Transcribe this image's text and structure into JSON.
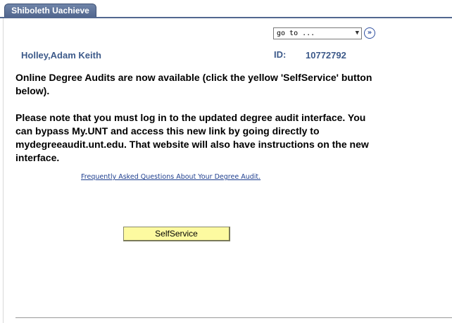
{
  "tab": {
    "label": "Shiboleth Uachieve"
  },
  "navigation": {
    "goto_value": "go to ...",
    "goto_icon": "chevron-down-icon",
    "go_icon": "double-chevron-right-icon"
  },
  "student": {
    "name": "Holley,Adam Keith",
    "id_label": "ID:",
    "id_value": "10772792"
  },
  "message": {
    "line1": "Online Degree Audits are now available (click the yellow 'SelfService' button below).",
    "line2": "Please note that you must log in to the updated degree audit interface. You can bypass My.UNT and access this new link by going directly to mydegreeaudit.unt.edu.  That website will also have instructions on the new interface."
  },
  "links": {
    "faq": "Frequently Asked Questions About Your Degree Audit."
  },
  "actions": {
    "selfservice_label": "SelfService"
  },
  "colors": {
    "tab_background": "#52678f",
    "label_text": "#3d5a8a",
    "button_background": "#fdfaa0",
    "link_text": "#1f3f8f"
  }
}
